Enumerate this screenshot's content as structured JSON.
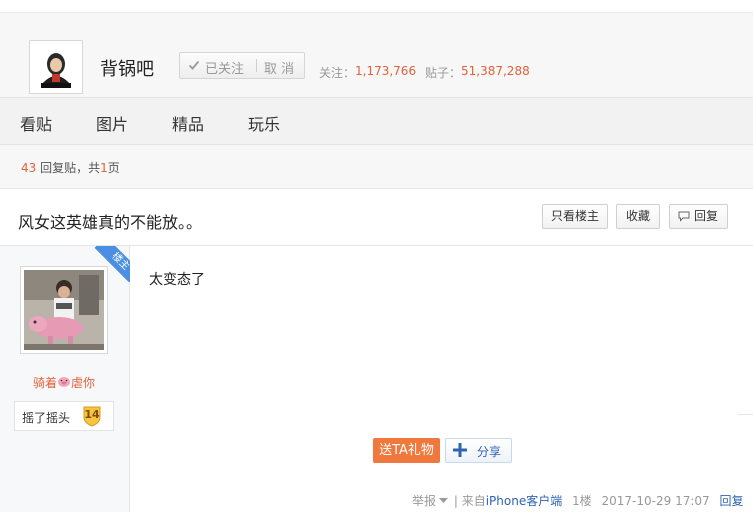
{
  "forum": {
    "name": "背锅吧",
    "logo_icon": "forum-logo-icon",
    "follow_label": "已关注",
    "unfollow_label": "取 消",
    "followers_label": "关注：",
    "followers_value": "1,173,766",
    "posts_label": "贴子：",
    "posts_value": "51,387,288"
  },
  "nav": {
    "items": [
      "看贴",
      "图片",
      "精品",
      "玩乐"
    ]
  },
  "reply_summary": {
    "count": "43",
    "count_suffix": " 回复贴，共",
    "pages": "1",
    "pages_suffix": "页"
  },
  "thread": {
    "title": "风女这英雄真的不能放。。",
    "only_op_label": "只看楼主",
    "favorite_label": "收藏",
    "reply_label": "回复"
  },
  "post": {
    "op_badge": "楼主",
    "author": {
      "name_part1": "骑着",
      "name_part2": "虐你",
      "level_label": "摇了摇头",
      "level_number": "14"
    },
    "content": "太变态了",
    "gift_label": "送TA礼物",
    "share_label": "分享",
    "meta": {
      "report": "举报",
      "source_prefix": " | 来自",
      "source": "iPhone客户端",
      "floor": "1楼",
      "time": "2017-10-29 17:07",
      "reply": "回复"
    }
  },
  "colors": {
    "accent": "#e1623a",
    "link": "#2d64b3",
    "badge_blue": "#4b8fe3",
    "gift_orange": "#f0783c"
  }
}
